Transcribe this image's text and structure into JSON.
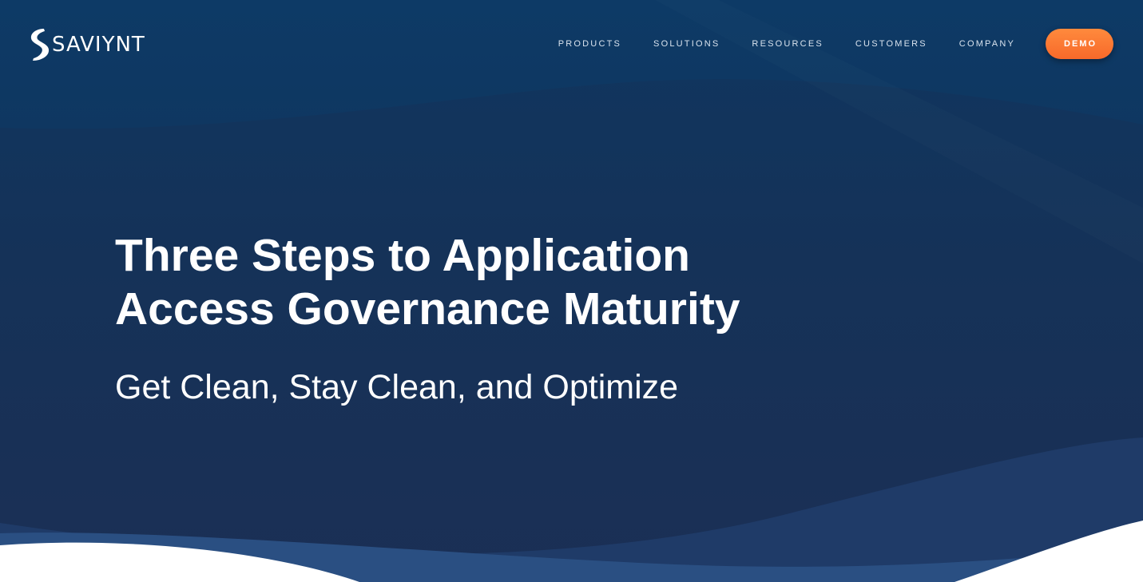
{
  "brand": {
    "name": "SAVIYNT",
    "logo_icon": "saviynt-s-icon"
  },
  "nav": {
    "links": [
      {
        "label": "PRODUCTS"
      },
      {
        "label": "SOLUTIONS"
      },
      {
        "label": "RESOURCES"
      },
      {
        "label": "CUSTOMERS"
      },
      {
        "label": "COMPANY"
      }
    ],
    "cta_label": "DEMO"
  },
  "hero": {
    "title_line1": "Three Steps to Application",
    "title_line2": "Access Governance Maturity",
    "subtitle": "Get Clean, Stay Clean, and Optimize"
  },
  "colors": {
    "background": "#153258",
    "wave_light": "#1f3b68",
    "wave_lighter": "#284d80",
    "cta": "#f7692a",
    "text": "#ffffff"
  }
}
